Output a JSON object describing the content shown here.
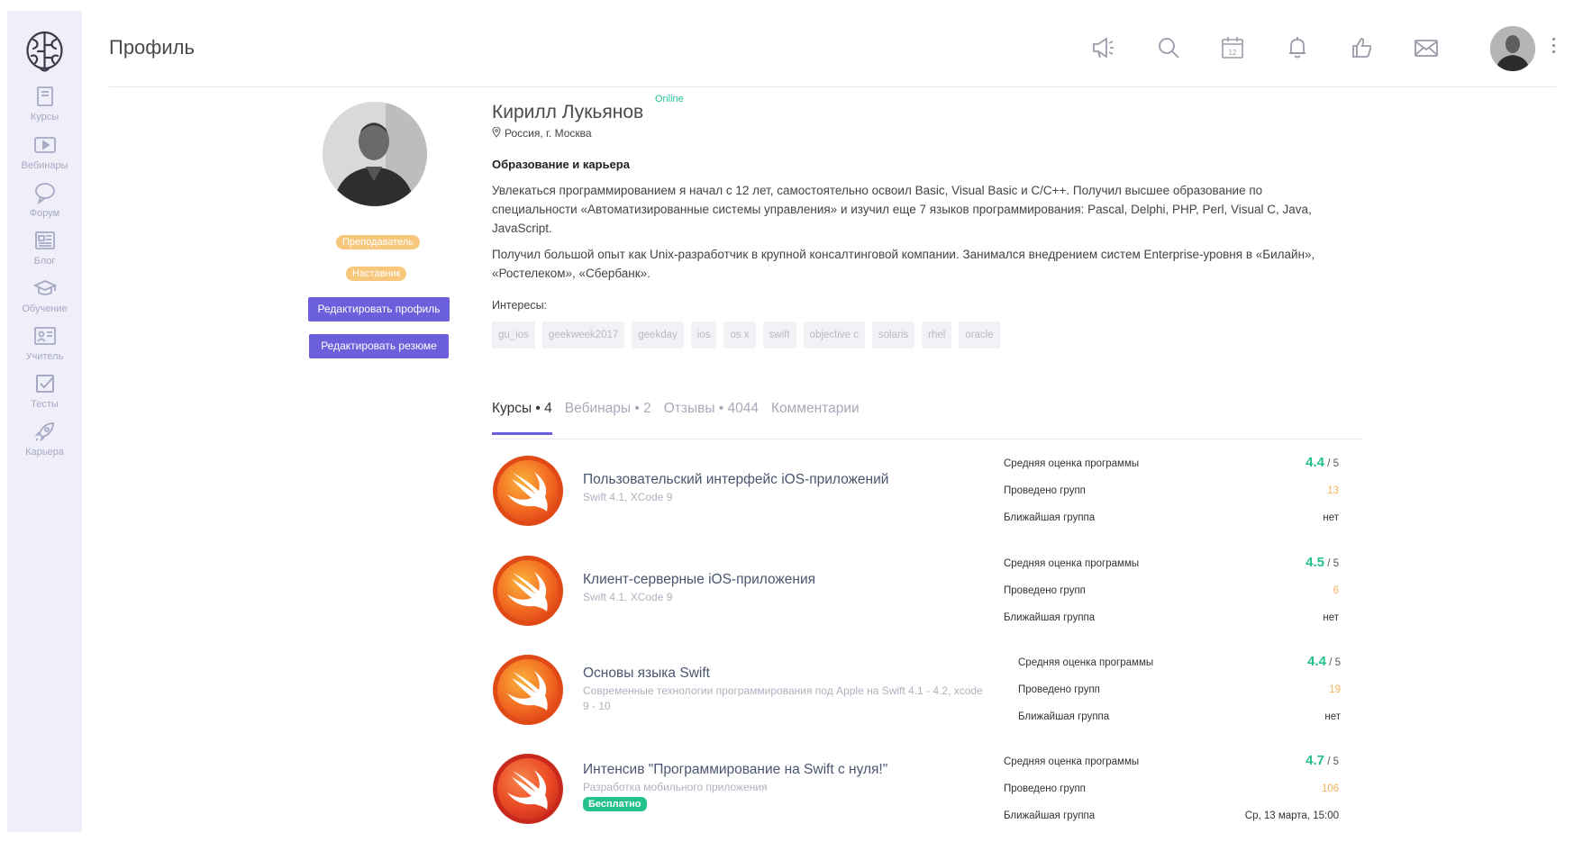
{
  "header": {
    "title": "Профиль",
    "icons": [
      "megaphone-icon",
      "search-icon",
      "calendar-icon",
      "bell-icon",
      "like-icon",
      "mail-icon"
    ],
    "calendar_day": "12"
  },
  "sidebar": {
    "items": [
      {
        "label": "Курсы",
        "icon": "book-icon"
      },
      {
        "label": "Вебинары",
        "icon": "play-icon"
      },
      {
        "label": "Форум",
        "icon": "chat-icon"
      },
      {
        "label": "Блог",
        "icon": "news-icon"
      },
      {
        "label": "Обучение",
        "icon": "graduation-cap-icon"
      },
      {
        "label": "Учитель",
        "icon": "teacher-icon"
      },
      {
        "label": "Тесты",
        "icon": "checkbox-icon"
      },
      {
        "label": "Карьера",
        "icon": "rocket-icon"
      }
    ]
  },
  "profile": {
    "name": "Кирилл Лукьянов",
    "status": "Online",
    "location": "Россия, г. Москва",
    "badges": [
      "Преподаватель",
      "Наставник"
    ],
    "edit_profile": "Редактировать профиль",
    "edit_resume": "Редактировать резюме",
    "section_title": "Образование и карьера",
    "para1_line1": "Увлекаться программированием я начал с 12 лет, самостоятельно освоил Basic, Visual Basic и C/C++. Получил высшее образование по",
    "para1_line2": "специальности «Автоматизированные системы управления» и изучил еще 7 языков программирования: Pascal, Delphi, PHP, Perl, Visual C, Java,",
    "para1_line3": "JavaScript.",
    "para2_line1": "Получил большой опыт как Unix-разработчик в крупной консалтинговой компании. Занимался внедрением систем Enterprise-уровня в «Билайн»,",
    "para2_line2": "«Ростелеком», «Сбербанк».",
    "interests_label": "Интересы:",
    "interests": [
      "gu_ios",
      "geekweek2017",
      "geekday",
      "ios",
      "os x",
      "swift",
      "objective c",
      "solaris",
      "rhel",
      "oracle"
    ]
  },
  "tabs": [
    {
      "label": "Курсы • 4",
      "active": true
    },
    {
      "label": "Вебинары • 2",
      "active": false
    },
    {
      "label": "Отзывы • 4044",
      "active": false
    },
    {
      "label": "Комментарии",
      "active": false
    }
  ],
  "stat_labels": {
    "rating": "Средняя оценка программы",
    "groups": "Проведено групп",
    "next": "Ближайшая группа",
    "of": "/ 5"
  },
  "courses": [
    {
      "title": "Пользовательский интерфейс iOS-приложений",
      "sub": "Swift 4.1, XCode 9",
      "sub2": "",
      "rating": "4.4",
      "groups": "13",
      "next": "нет"
    },
    {
      "title": "Клиент-серверные iOS-приложения",
      "sub": "Swift 4.1, XCode 9",
      "sub2": "",
      "rating": "4.5",
      "groups": "6",
      "next": "нет"
    },
    {
      "title": "Основы языка Swift",
      "sub": "Современные технологии программирования под Apple на Swift 4.1 - 4.2, xcode",
      "sub2": "9 - 10",
      "rating": "4.4",
      "groups": "19",
      "next": "нет"
    },
    {
      "title": "Интенсив \"Программирование на Swift с нуля!\"",
      "sub": "Разработка мобильного приложения",
      "sub2": "",
      "badge": "Бесплатно",
      "rating": "4.7",
      "groups": "106",
      "next": "Ср, 13 марта, 15:00"
    }
  ],
  "colors": {
    "accent": "#6c5fdb",
    "sidebar_bg": "#efeff9",
    "green": "#22c28a",
    "orange": "#f7b35a",
    "badge": "#f7c77c"
  }
}
